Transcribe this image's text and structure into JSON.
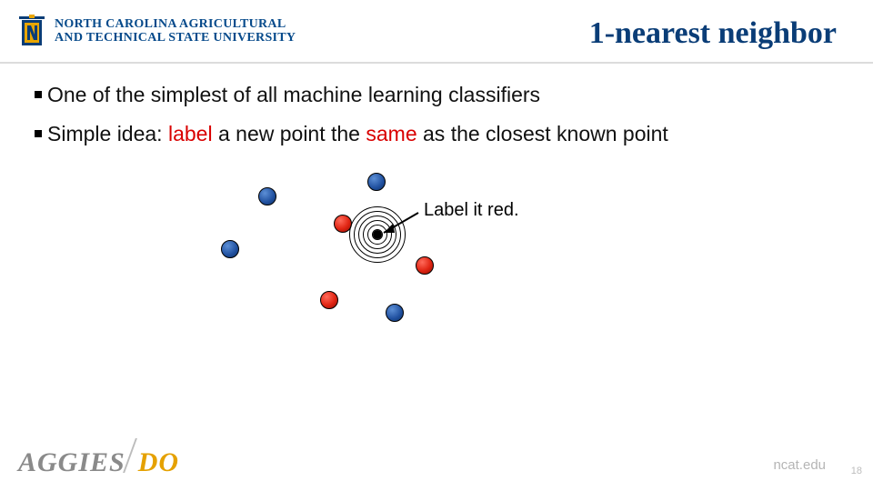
{
  "header": {
    "university_line1": "NORTH CAROLINA AGRICULTURAL",
    "university_line2": "AND TECHNICAL STATE UNIVERSITY",
    "title": "1-nearest neighbor"
  },
  "bullets": {
    "b1": "One of the simplest of all machine learning classifiers",
    "b2_pre": "Simple idea:  ",
    "b2_label": "label",
    "b2_mid": " a new point the ",
    "b2_same": "same",
    "b2_post": " as the closest known point"
  },
  "diagram": {
    "label": "Label it red."
  },
  "footer": {
    "aggies_grey": "AGGIES",
    "aggies_gold": "DO",
    "url": "ncat.edu",
    "page": "18"
  },
  "chart_data": {
    "type": "scatter",
    "title": "1-nearest neighbor illustration",
    "series": [
      {
        "name": "blue",
        "points": [
          [
            34,
            38
          ],
          [
            -7,
            96
          ],
          [
            154,
            22
          ],
          [
            174,
            166
          ]
        ]
      },
      {
        "name": "red",
        "points": [
          [
            117,
            68
          ],
          [
            102,
            152
          ],
          [
            207,
            114
          ]
        ]
      },
      {
        "name": "query",
        "points": [
          [
            165,
            90
          ]
        ],
        "predicted_label": "red"
      }
    ],
    "annotations": [
      "Label it red."
    ]
  }
}
